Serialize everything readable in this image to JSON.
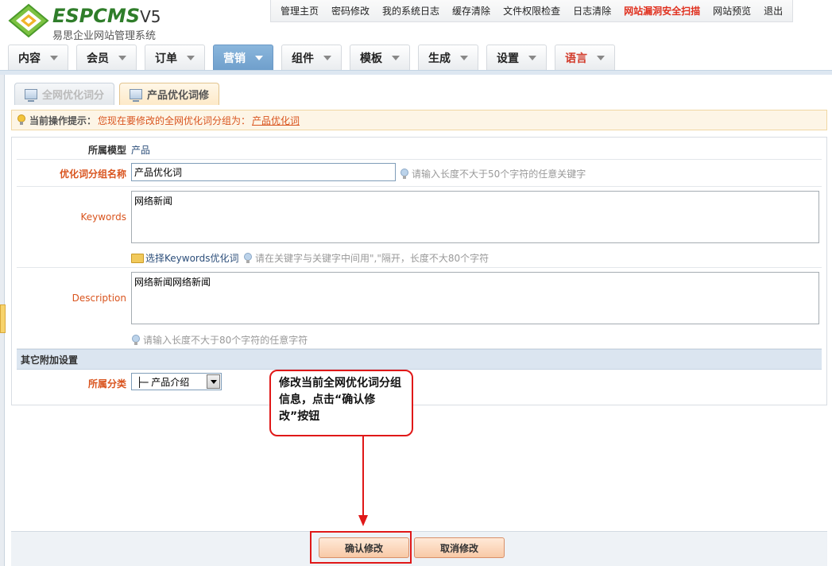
{
  "logo": {
    "brand": "ESPCMS",
    "version": "V5",
    "subtitle": "易思企业网站管理系统"
  },
  "top_links": [
    "管理主页",
    "密码修改",
    "我的系统日志",
    "缓存清除",
    "文件权限检查",
    "日志清除",
    "网站漏洞安全扫描",
    "网站预览",
    "退出"
  ],
  "main_tabs": [
    "内容",
    "会员",
    "订单",
    "营销",
    "组件",
    "模板",
    "生成",
    "设置",
    "语言"
  ],
  "sub_tabs": [
    "全网优化词分",
    "产品优化词修"
  ],
  "notice": {
    "label": "当前操作提示：",
    "message": "您现在要修改的全网优化词分组为：",
    "link": "产品优化词"
  },
  "form": {
    "model_label": "所属模型",
    "model_value": "产品",
    "group_label": "优化词分组名称",
    "group_value": "产品优化词",
    "group_hint": "请输入长度不大于50个字符的任意关键字",
    "keywords_label": "Keywords",
    "keywords_value": "网络新闻",
    "keywords_pick": "选择Keywords优化词",
    "keywords_hint": "请在关键字与关键字中间用\",\"隔开，长度不大80个字符",
    "description_label": "Description",
    "description_value": "网络新闻网络新闻",
    "description_hint": "请输入长度不大于80个字符的任意字符",
    "section_title": "其它附加设置",
    "category_label": "所属分类",
    "category_value": "├─ 产品介绍"
  },
  "buttons": {
    "confirm": "确认修改",
    "cancel": "取消修改"
  },
  "callout": "修改当前全网优化词分组信息，点击“确认修改”按钮",
  "colors": {
    "accent": "#d9541e",
    "active_tab": "#6f9fcc",
    "annotation": "#e01818"
  }
}
